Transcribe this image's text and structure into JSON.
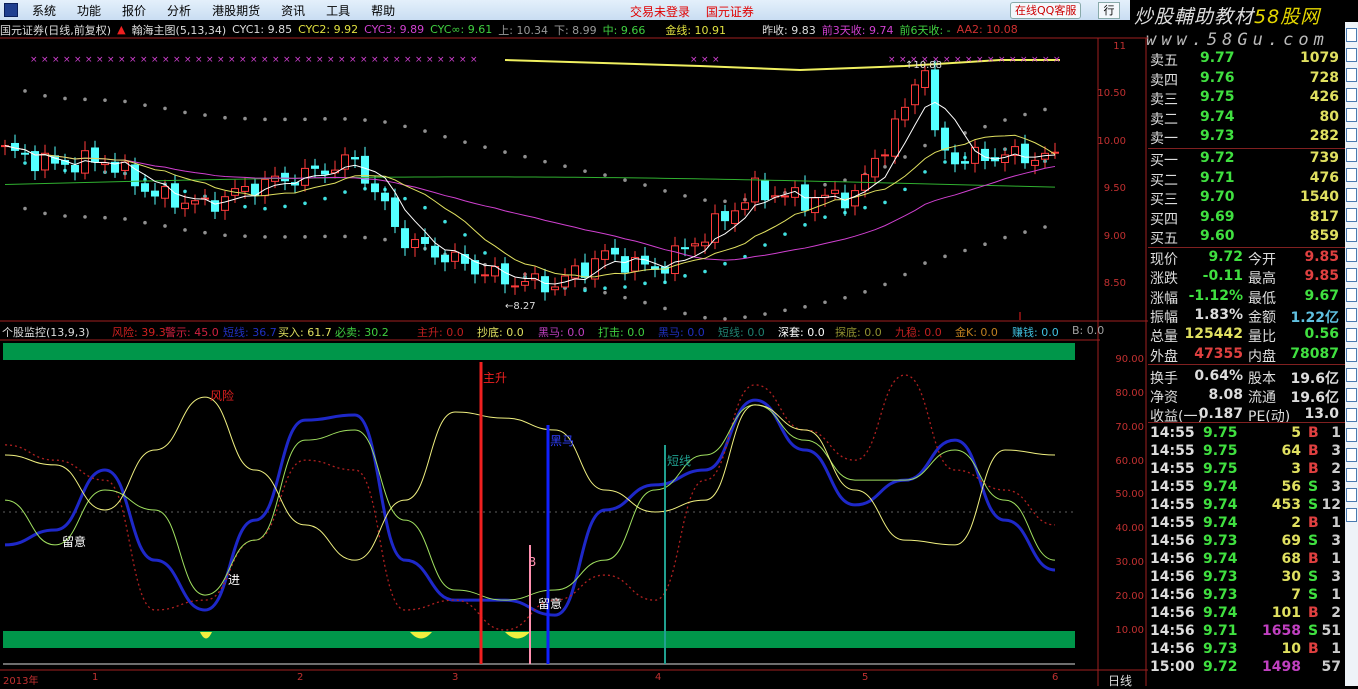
{
  "menu": {
    "items": [
      "系统",
      "功能",
      "报价",
      "分析",
      "港股期货",
      "资讯",
      "工具",
      "帮助"
    ],
    "trade_status": "交易未登录",
    "broker": "国元证券",
    "qq_button": "在线QQ客服",
    "hang_button": "行"
  },
  "watermark": {
    "title": "炒股輔助教材",
    "brand": "58股网",
    "url": "www.58Gu.com"
  },
  "info": {
    "stock": "国元证券(日线,前复权)",
    "indicator": "翰海主图(5,13,34)",
    "cyc1": "CYC1: 9.85",
    "cyc2": "CYC2: 9.92",
    "cyc3": "CYC3: 9.89",
    "cycinf": "CYC∞: 9.61",
    "up": "上: 10.34",
    "down": "下: 8.99",
    "mid": "中: 9.66",
    "gold": "金线: 10.91",
    "prev_close": "昨收: 9.83",
    "prev3": "前3天收: 9.74",
    "prev6": "前6天收: -",
    "aa2": "AA2: 10.08"
  },
  "indicator_header": {
    "name": "个股监控(13,9,3)",
    "items": [
      {
        "t": "风险: 39.3",
        "c": "#d02020"
      },
      {
        "t": "警示: 45.0",
        "c": "#d02040"
      },
      {
        "t": "短线: 36.7",
        "c": "#2030c0"
      },
      {
        "t": "买入: 61.7",
        "c": "#e0e060"
      },
      {
        "t": "必卖: 30.2",
        "c": "#40d040"
      },
      {
        "t": "主升: 0.0",
        "c": "#c02020"
      },
      {
        "t": "抄底: 0.0",
        "c": "#e0e060"
      },
      {
        "t": "黑马: 0.0",
        "c": "#c040c0"
      },
      {
        "t": "打击: 0.0",
        "c": "#40d040"
      },
      {
        "t": "黑马: 0.0",
        "c": "#2030c0"
      },
      {
        "t": "短线: 0.0",
        "c": "#208070"
      },
      {
        "t": "深套: 0.0",
        "c": "#ffffff"
      },
      {
        "t": "探底: 0.0",
        "c": "#909030"
      },
      {
        "t": "九稳: 0.0",
        "c": "#c02020"
      },
      {
        "t": "金K: 0.0",
        "c": "#c08020"
      },
      {
        "t": "赚钱: 0.0",
        "c": "#40c0e0"
      },
      {
        "t": "B: 0.0",
        "c": "#a0a0a0"
      }
    ]
  },
  "price_axis": [
    "11",
    "10.50",
    "10.00",
    "9.50",
    "9.00",
    "8.50"
  ],
  "ind_axis": [
    "90.00",
    "80.00",
    "70.00",
    "60.00",
    "50.00",
    "40.00",
    "30.00",
    "20.00",
    "10.00"
  ],
  "x_axis": [
    "2013年",
    "1",
    "2",
    "3",
    "4",
    "5",
    "6"
  ],
  "period_label": "日线",
  "chart_annotations": {
    "high": "10.88",
    "low": "8.27",
    "signals": [
      "主升",
      "黑马",
      "短线",
      "B",
      "留意",
      "进",
      "留意",
      "风险"
    ]
  },
  "price_keypoints": [
    9.91,
    9.76,
    9.81,
    9.44,
    9.33,
    9.54,
    9.65,
    9.81,
    8.96,
    8.75,
    8.54,
    8.49,
    8.81,
    8.65,
    9.02,
    9.49,
    9.39,
    9.44,
    10.34,
    9.81,
    9.86,
    9.83
  ],
  "indicator_series": {
    "yellow": [
      61.9,
      59.0,
      45.7,
      63.4,
      79.0,
      57.5,
      41.3,
      30.9,
      48.6,
      74.6,
      72.8,
      69.3,
      51.6,
      45.1,
      48.6,
      76.7,
      69.3,
      51.6,
      36.8,
      35.4,
      63.4,
      61.9
    ],
    "green": [
      48.6,
      35.4,
      51.6,
      45.7,
      20.6,
      36.8,
      66.3,
      69.3,
      42.7,
      22.1,
      19.1,
      22.1,
      30.9,
      51.6,
      61.9,
      76.7,
      66.3,
      54.5,
      54.5,
      63.4,
      48.6,
      30.9
    ],
    "blue": [
      35.4,
      39.8,
      57.5,
      30.9,
      16.2,
      42.7,
      72.2,
      73.7,
      30.9,
      19.1,
      19.1,
      14.7,
      45.7,
      53.1,
      57.5,
      78.1,
      63.4,
      47.2,
      54.5,
      66.3,
      42.7,
      28.0
    ],
    "red": [
      64.9,
      60.4,
      54.5,
      16.2,
      19.1,
      36.8,
      60.4,
      57.5,
      16.2,
      19.1,
      10.3,
      19.1,
      26.5,
      19.1,
      54.5,
      82.6,
      69.3,
      60.4,
      85.5,
      57.5,
      51.6,
      41.3
    ]
  },
  "quote": {
    "asks": [
      {
        "l": "卖五",
        "p": "9.77",
        "v": "1079"
      },
      {
        "l": "卖四",
        "p": "9.76",
        "v": "728"
      },
      {
        "l": "卖三",
        "p": "9.75",
        "v": "426"
      },
      {
        "l": "卖二",
        "p": "9.74",
        "v": "80"
      },
      {
        "l": "卖一",
        "p": "9.73",
        "v": "282"
      }
    ],
    "bids": [
      {
        "l": "买一",
        "p": "9.72",
        "v": "739"
      },
      {
        "l": "买二",
        "p": "9.71",
        "v": "476"
      },
      {
        "l": "买三",
        "p": "9.70",
        "v": "1540"
      },
      {
        "l": "买四",
        "p": "9.69",
        "v": "817"
      },
      {
        "l": "买五",
        "p": "9.60",
        "v": "859"
      }
    ],
    "stats": [
      {
        "l1": "现价",
        "v1": "9.72",
        "c1": "#40e040",
        "l2": "今开",
        "v2": "9.85",
        "c2": "#e04040"
      },
      {
        "l1": "涨跌",
        "v1": "-0.11",
        "c1": "#40e040",
        "l2": "最高",
        "v2": "9.85",
        "c2": "#e04040"
      },
      {
        "l1": "涨幅",
        "v1": "-1.12%",
        "c1": "#40e040",
        "l2": "最低",
        "v2": "9.67",
        "c2": "#40e040"
      },
      {
        "l1": "振幅",
        "v1": "1.83%",
        "c1": "#dddddd",
        "l2": "金额",
        "v2": "1.22亿",
        "c2": "#60c0e0"
      },
      {
        "l1": "总量",
        "v1": "125442",
        "c1": "#e0e060",
        "l2": "量比",
        "v2": "0.56",
        "c2": "#40e040"
      },
      {
        "l1": "外盘",
        "v1": "47355",
        "c1": "#e04040",
        "l2": "内盘",
        "v2": "78087",
        "c2": "#40e040"
      },
      {
        "l1": "换手",
        "v1": "0.64%",
        "c1": "#dddddd",
        "l2": "股本",
        "v2": "19.6亿",
        "c2": "#dddddd"
      },
      {
        "l1": "净资",
        "v1": "8.08",
        "c1": "#dddddd",
        "l2": "流通",
        "v2": "19.6亿",
        "c2": "#dddddd"
      },
      {
        "l1": "收益(一)",
        "v1": "0.187",
        "c1": "#dddddd",
        "l2": "PE(动)",
        "v2": "13.0",
        "c2": "#dddddd"
      }
    ],
    "ticks": [
      {
        "t": "14:55",
        "p": "9.75",
        "v": "5",
        "bs": "B",
        "n": "1"
      },
      {
        "t": "14:55",
        "p": "9.75",
        "v": "64",
        "bs": "B",
        "n": "3"
      },
      {
        "t": "14:55",
        "p": "9.75",
        "v": "3",
        "bs": "B",
        "n": "2"
      },
      {
        "t": "14:55",
        "p": "9.74",
        "v": "56",
        "bs": "S",
        "n": "3"
      },
      {
        "t": "14:55",
        "p": "9.74",
        "v": "453",
        "bs": "S",
        "n": "12"
      },
      {
        "t": "14:55",
        "p": "9.74",
        "v": "2",
        "bs": "B",
        "n": "1"
      },
      {
        "t": "14:56",
        "p": "9.73",
        "v": "69",
        "bs": "S",
        "n": "3"
      },
      {
        "t": "14:56",
        "p": "9.74",
        "v": "68",
        "bs": "B",
        "n": "1"
      },
      {
        "t": "14:56",
        "p": "9.73",
        "v": "30",
        "bs": "S",
        "n": "3"
      },
      {
        "t": "14:56",
        "p": "9.73",
        "v": "7",
        "bs": "S",
        "n": "1"
      },
      {
        "t": "14:56",
        "p": "9.74",
        "v": "101",
        "bs": "B",
        "n": "2"
      },
      {
        "t": "14:56",
        "p": "9.71",
        "v": "1658",
        "bs": "S",
        "n": "51"
      },
      {
        "t": "14:56",
        "p": "9.73",
        "v": "10",
        "bs": "B",
        "n": "1"
      },
      {
        "t": "15:00",
        "p": "9.72",
        "v": "1498",
        "bs": "",
        "n": "57"
      }
    ]
  },
  "colors": {
    "up": "#ff3c3c",
    "down": "#54ffff",
    "bg": "#000000",
    "axis": "#a02020"
  }
}
